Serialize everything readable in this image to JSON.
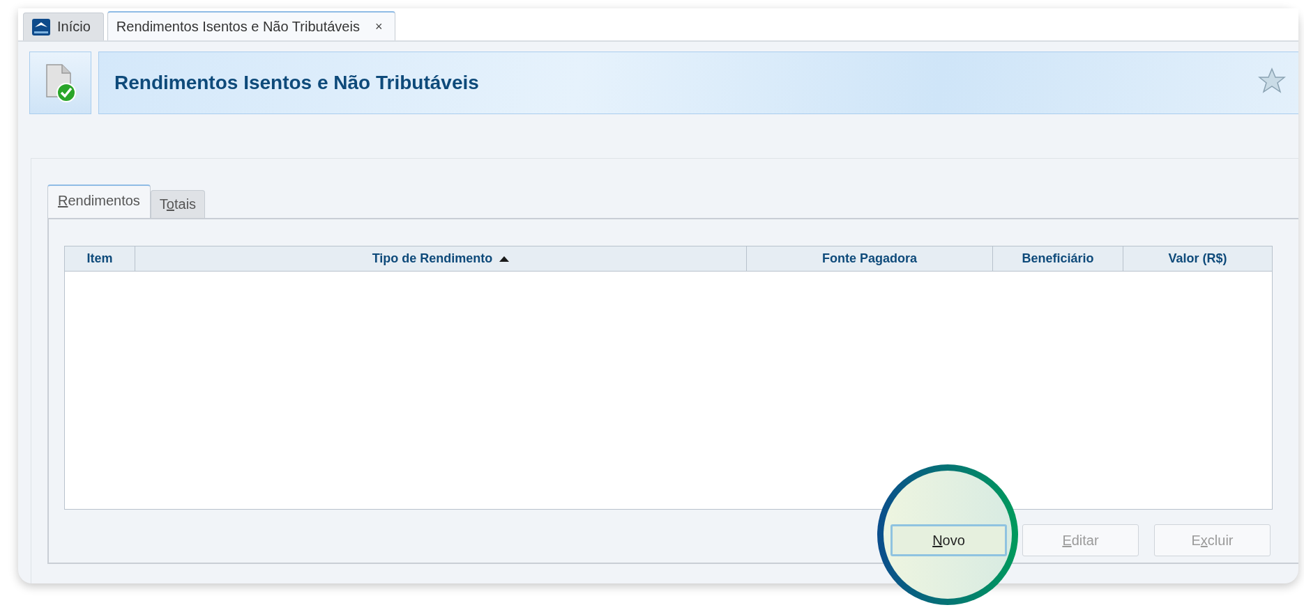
{
  "tabs": [
    {
      "label": "Início",
      "selected": false
    },
    {
      "label": "Rendimentos Isentos e Não Tributáveis",
      "close": "×",
      "selected": true
    }
  ],
  "header": {
    "title": "Rendimentos Isentos e Não Tributáveis"
  },
  "sub_tabs": [
    {
      "key": "R",
      "rest": "endimentos",
      "selected": true
    },
    {
      "prefix": "T",
      "key": "o",
      "rest": "tais",
      "selected": false
    }
  ],
  "table": {
    "columns": [
      {
        "label": "Item",
        "sorted": false
      },
      {
        "label": "Tipo de Rendimento",
        "sorted": true
      },
      {
        "label": "Fonte Pagadora",
        "sorted": false
      },
      {
        "label": "Beneficiário",
        "sorted": false
      },
      {
        "label": "Valor (R$)",
        "sorted": false
      }
    ]
  },
  "buttons": [
    {
      "key": "N",
      "rest": "ovo",
      "disabled": false,
      "highlighted": true
    },
    {
      "key": "E",
      "rest": "ditar",
      "disabled": true,
      "highlighted": false
    },
    {
      "prefix": "E",
      "key": "x",
      "rest": "cluir",
      "disabled": true,
      "highlighted": false
    }
  ]
}
